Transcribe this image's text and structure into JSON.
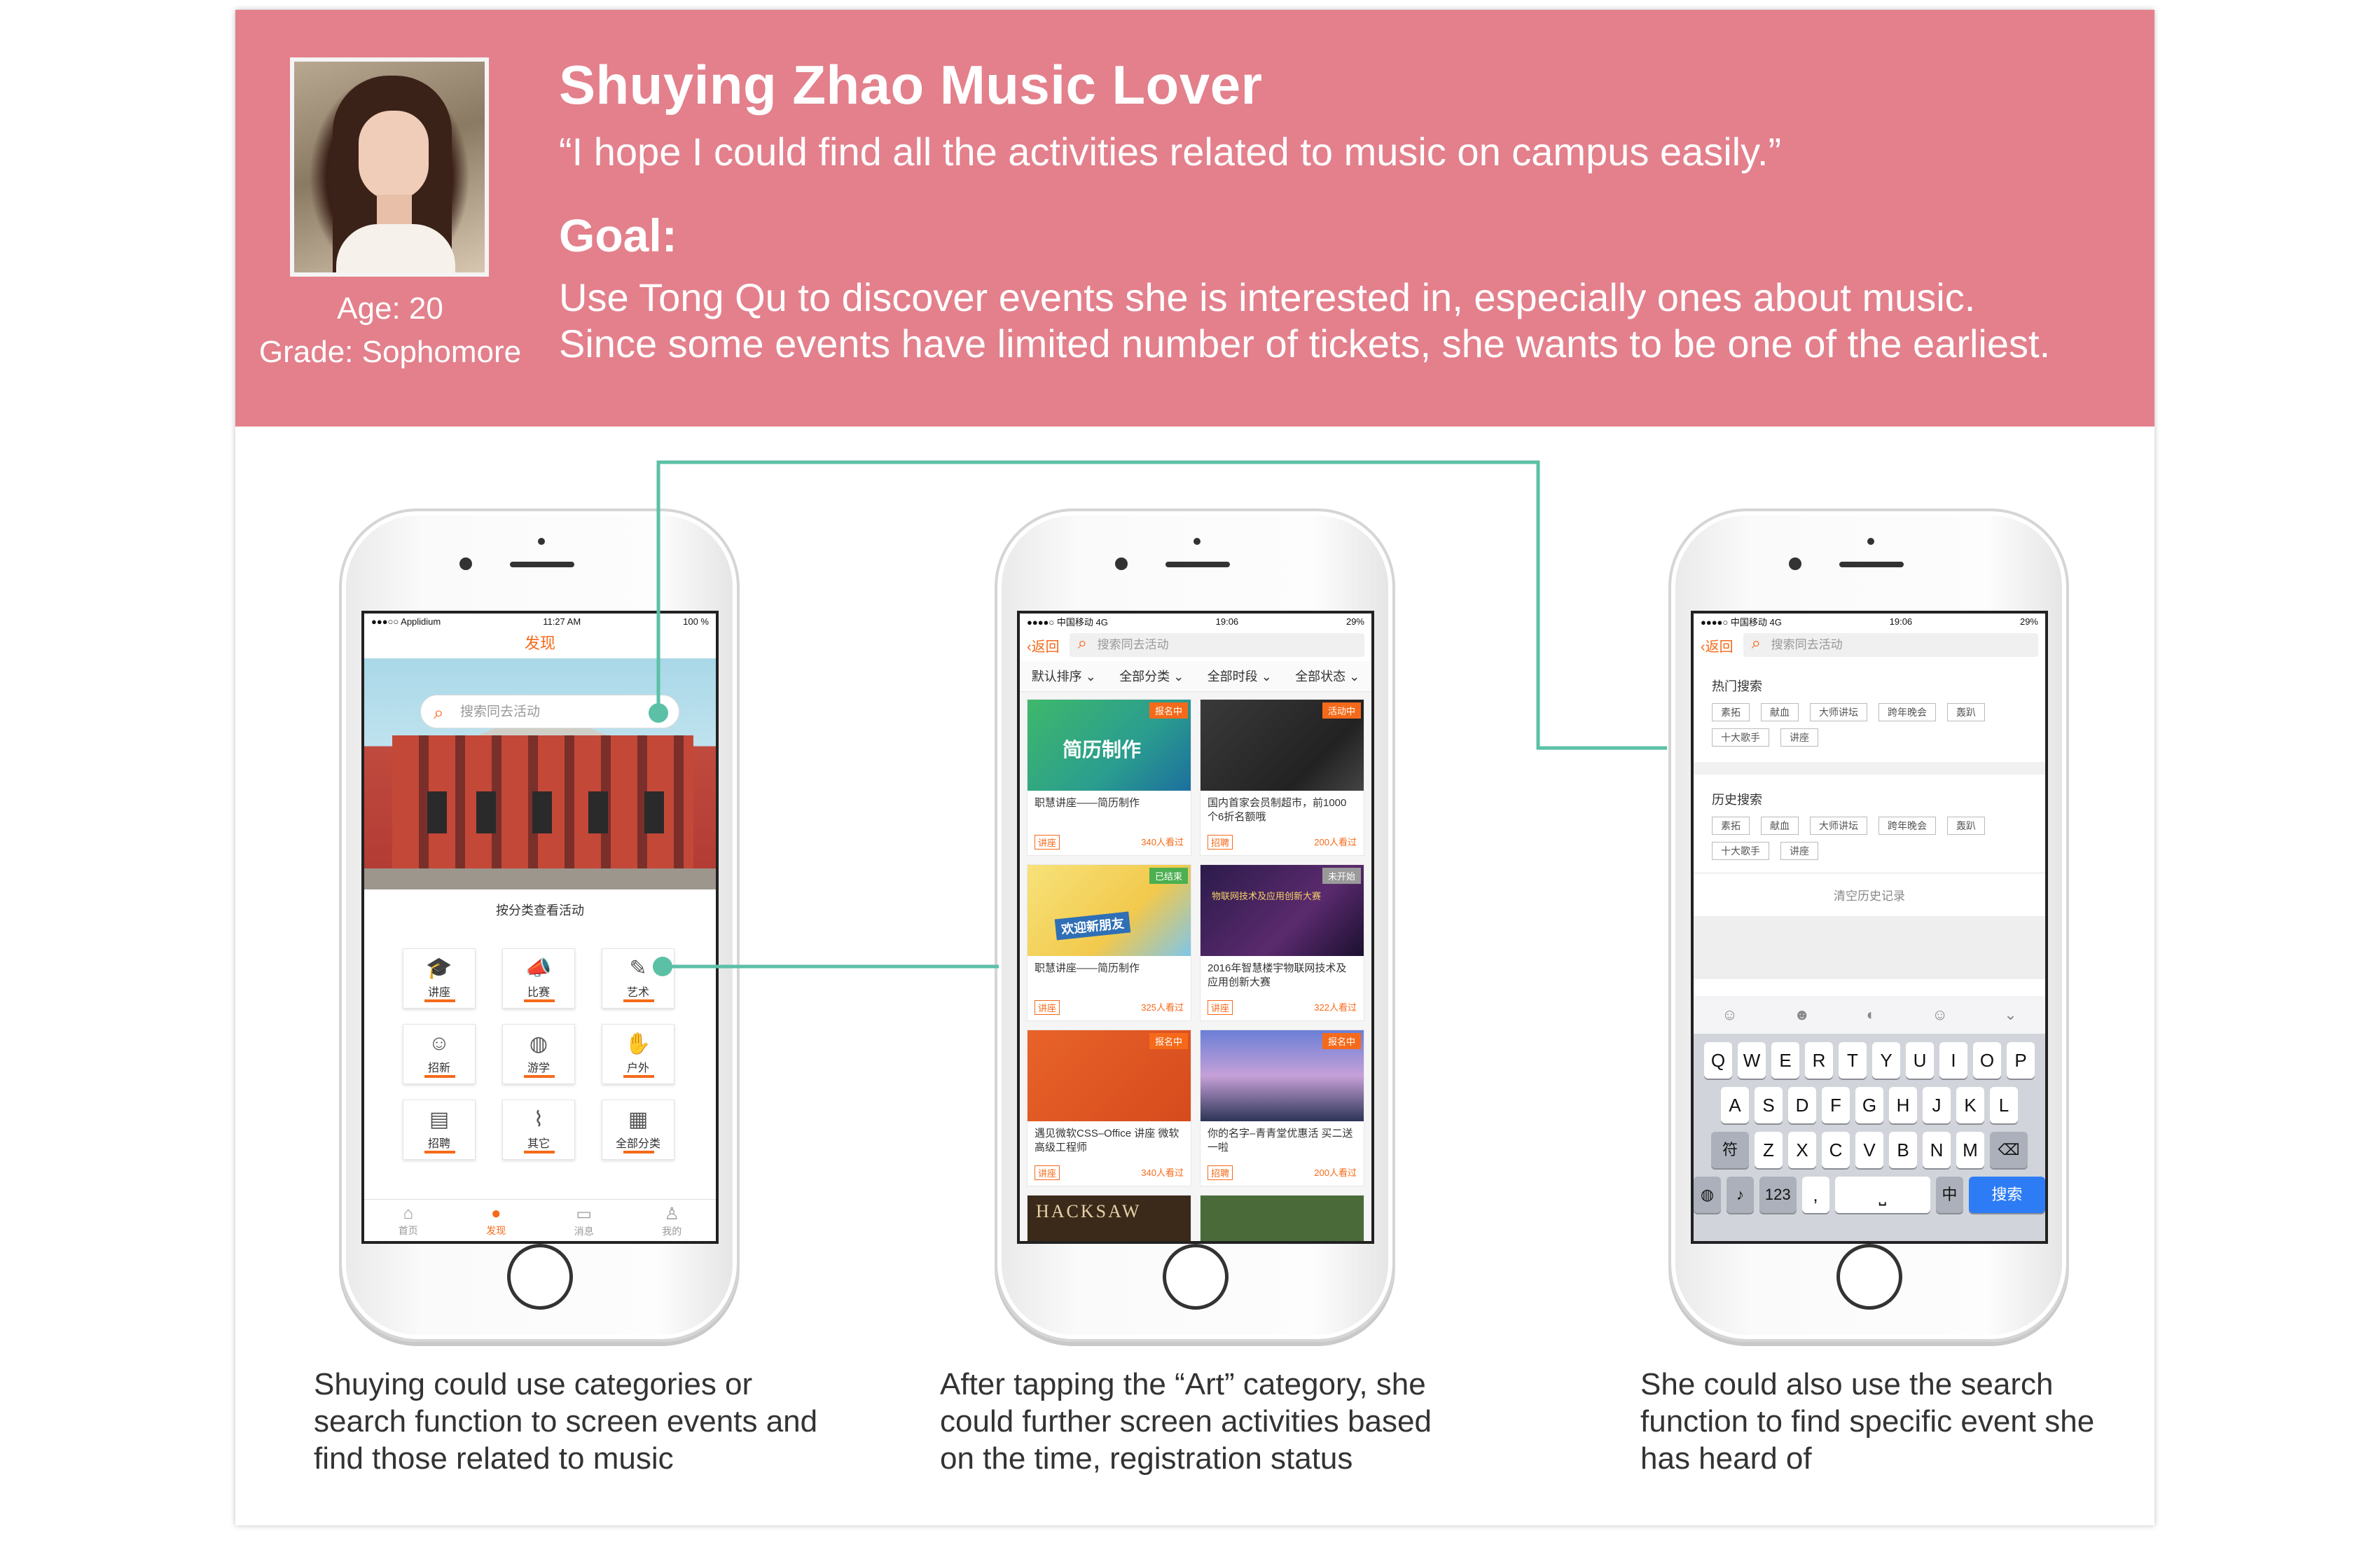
{
  "persona": {
    "name_title": "Shuying Zhao Music Lover",
    "quote": "“I hope I could find all the activities related to music on campus easily.”",
    "goal_heading": "Goal:",
    "goal_lines": [
      "Use Tong Qu to discover events she is interested in, especially ones about music.",
      "Since some events have limited number of tickets, she wants to be one of the earliest."
    ],
    "age": "Age: 20",
    "grade": "Grade: Sophomore"
  },
  "colors": {
    "header_bg": "#e3808c",
    "accent_orange": "#f56a1a",
    "connector": "#5cc0a6"
  },
  "phone1": {
    "status": {
      "carrier": "●●●○○ Applidium",
      "time": "11:27 AM",
      "battery": "100 %"
    },
    "title": "发现",
    "search_placeholder": "搜索同去活动",
    "category_label": "按分类查看活动",
    "categories": [
      {
        "label": "讲座",
        "icon": "lecture-icon"
      },
      {
        "label": "比赛",
        "icon": "megaphone-icon"
      },
      {
        "label": "艺术",
        "icon": "brush-icon"
      },
      {
        "label": "招新",
        "icon": "recruit-icon"
      },
      {
        "label": "游学",
        "icon": "globe-icon"
      },
      {
        "label": "户外",
        "icon": "hand-icon"
      },
      {
        "label": "招聘",
        "icon": "job-icon"
      },
      {
        "label": "其它",
        "icon": "clip-icon"
      },
      {
        "label": "全部分类",
        "icon": "calendar-icon"
      }
    ],
    "tabs": [
      {
        "label": "首页",
        "icon": "home-icon"
      },
      {
        "label": "发现",
        "icon": "discover-icon"
      },
      {
        "label": "消息",
        "icon": "message-icon"
      },
      {
        "label": "我的",
        "icon": "profile-icon"
      }
    ]
  },
  "phone2": {
    "status": {
      "carrier": "●●●●○ 中国移动 4G",
      "time": "19:06",
      "battery": "29%"
    },
    "back_label": "返回",
    "search_placeholder": "搜索同去活动",
    "filters": [
      "默认排序",
      "全部分类",
      "全部时段",
      "全部状态"
    ],
    "cards": [
      {
        "title": "职慧讲座——简历制作",
        "tag": "讲座",
        "views": "340人看过",
        "badge": "报名中",
        "badge_type": "open",
        "image_text": "简历制作"
      },
      {
        "title": "国内首家会员制超市，前1000个6折名额哦",
        "tag": "招聘",
        "views": "200人看过",
        "badge": "活动中",
        "badge_type": "open",
        "image_text": ""
      },
      {
        "title": "职慧讲座——简历制作",
        "tag": "讲座",
        "views": "325人看过",
        "badge": "已结束",
        "badge_type": "done",
        "image_text": "欢迎新朋友"
      },
      {
        "title": "2016年智慧楼宇物联网技术及应用创新大赛",
        "tag": "讲座",
        "views": "322人看过",
        "badge": "未开始",
        "badge_type": "soon",
        "image_text": "物联网技术及应用创新大赛"
      },
      {
        "title": "遇见微软CSS–Office 讲座 微软高级工程师",
        "tag": "讲座",
        "views": "340人看过",
        "badge": "报名中",
        "badge_type": "open",
        "image_text": ""
      },
      {
        "title": "你的名字–青青堂优惠活 买二送一啦",
        "tag": "招聘",
        "views": "200人看过",
        "badge": "报名中",
        "badge_type": "open",
        "image_text": ""
      }
    ],
    "partial_card_text": "HACKSAW"
  },
  "phone3": {
    "status": {
      "carrier": "●●●●○ 中国移动 4G",
      "time": "19:06",
      "battery": "29%"
    },
    "back_label": "返回",
    "search_placeholder": "搜索同去活动",
    "hot_title": "热门搜索",
    "hot_tags": [
      "素拓",
      "献血",
      "大师讲坛",
      "跨年晚会",
      "轰趴",
      "十大歌手",
      "讲座"
    ],
    "history_title": "历史搜索",
    "history_tags": [
      "素拓",
      "献血",
      "大师讲坛",
      "跨年晚会",
      "轰趴",
      "十大歌手",
      "讲座"
    ],
    "clear_label": "清空历史记录",
    "keyboard": {
      "row1": [
        "Q",
        "W",
        "E",
        "R",
        "T",
        "Y",
        "U",
        "I",
        "O",
        "P"
      ],
      "row2": [
        "A",
        "S",
        "D",
        "F",
        "G",
        "H",
        "J",
        "K",
        "L"
      ],
      "row3": [
        "Z",
        "X",
        "C",
        "V",
        "B",
        "N",
        "M"
      ],
      "shift": "符",
      "num": "123",
      "comma": ",",
      "lang": "中",
      "search": "搜索"
    }
  },
  "captions": [
    "Shuying could use categories or search function to screen events and find those related to music",
    "After tapping the “Art” category, she could further screen activities based on the time, registration status",
    "She could also use the search function to find specific event she has heard of"
  ]
}
